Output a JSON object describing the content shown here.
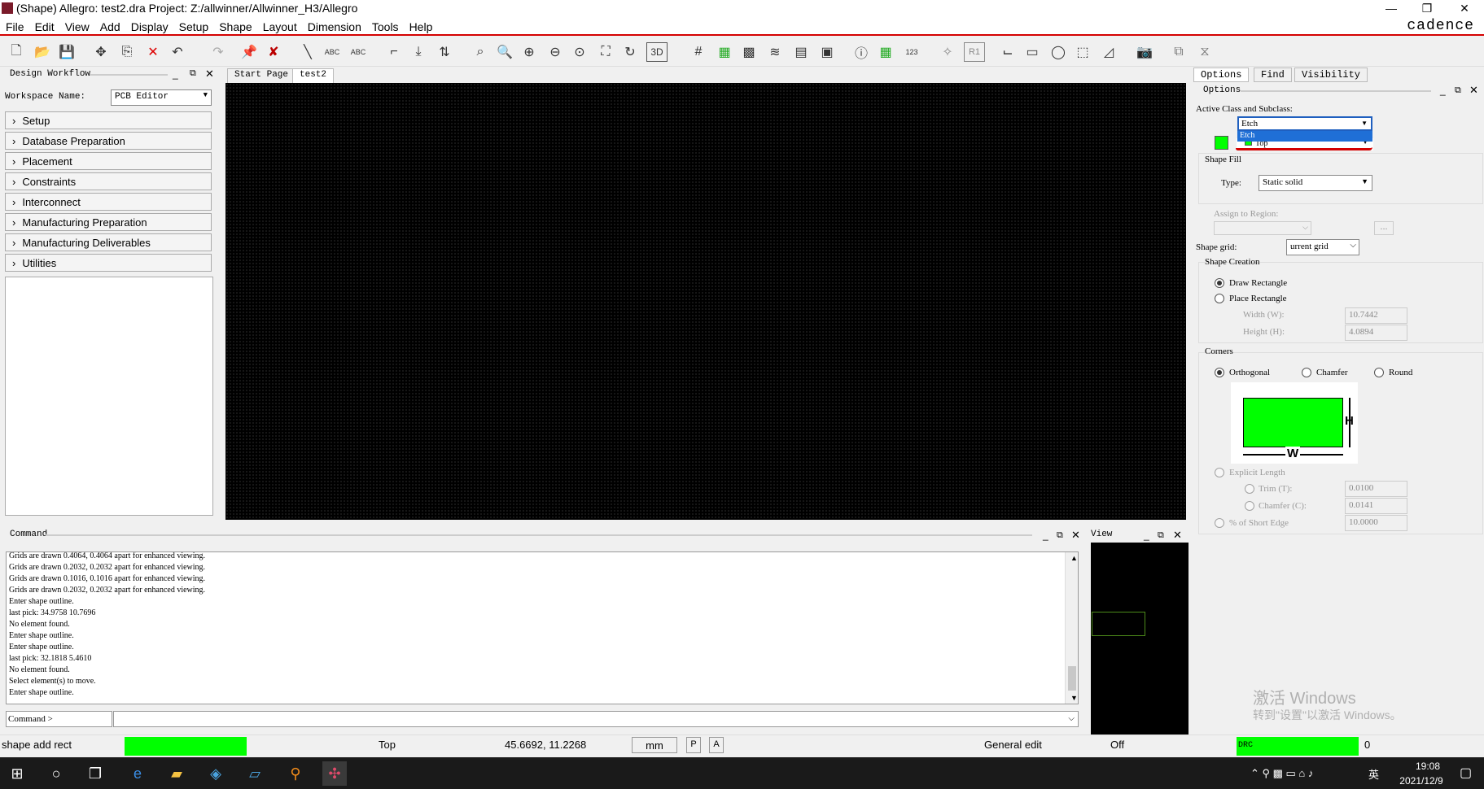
{
  "window": {
    "title": "(Shape) Allegro: test2.dra  Project: Z:/allwinner/Allwinner_H3/Allegro",
    "brand": "cadence"
  },
  "menu": [
    "File",
    "Edit",
    "View",
    "Add",
    "Display",
    "Setup",
    "Shape",
    "Layout",
    "Dimension",
    "Tools",
    "Help"
  ],
  "workflow": {
    "title": "Design Workflow",
    "workspace_label": "Workspace Name:",
    "workspace_value": "PCB Editor",
    "items": [
      "Setup",
      "Database Preparation",
      "Placement",
      "Constraints",
      "Interconnect",
      "Manufacturing Preparation",
      "Manufacturing Deliverables",
      "Utilities"
    ]
  },
  "tabs": [
    "Start Page",
    "test2"
  ],
  "command": {
    "title": "Command",
    "log": [
      "Grids are drawn 0.4064, 0.4064 apart for enhanced viewing.",
      "Grids are drawn 0.2032, 0.2032 apart for enhanced viewing.",
      "Grids are drawn 0.1016, 0.1016 apart for enhanced viewing.",
      "Grids are drawn 0.2032, 0.2032 apart for enhanced viewing.",
      "Enter shape outline.",
      "last pick:  34.9758 10.7696",
      "No element found.",
      "Enter shape outline.",
      "Enter shape outline.",
      "last pick:  32.1818 5.4610",
      "No element found.",
      "Select element(s) to move.",
      "Enter shape outline."
    ],
    "prompt": "Command >"
  },
  "view_title": "View",
  "options": {
    "tabs": [
      "Options",
      "Find",
      "Visibility"
    ],
    "title": "Options",
    "active_class_label": "Active Class and Subclass:",
    "class_value": "Etch",
    "class_option": "Etch",
    "subclass_value": "Top",
    "shape_fill_label": "Shape Fill",
    "type_label": "Type:",
    "type_value": "Static solid",
    "assign_region_label": "Assign to Region:",
    "assign_btn": "...",
    "shape_grid_label": "Shape grid:",
    "shape_grid_value": "urrent grid",
    "shape_creation_label": "Shape Creation",
    "draw_rect": "Draw Rectangle",
    "place_rect": "Place Rectangle",
    "width_label": "Width (W):",
    "width_value": "10.7442",
    "height_label": "Height (H):",
    "height_value": "4.0894",
    "corners_label": "Corners",
    "orthogonal": "Orthogonal",
    "chamfer": "Chamfer",
    "round": "Round",
    "diag_h": "H",
    "diag_w": "W",
    "explicit_length": "Explicit Length",
    "trim_label": "Trim (T):",
    "trim_value": "0.0100",
    "chamfer_c_label": "Chamfer (C):",
    "chamfer_c_value": "0.0141",
    "pct_label": "% of Short Edge",
    "pct_value": "10.0000"
  },
  "status": {
    "command": "shape add rect",
    "layer": "Top",
    "coords": "45.6692, 11.2268",
    "units": "mm",
    "p": "P",
    "a": "A",
    "mode": "General edit",
    "off": "Off",
    "drc": "DRC",
    "drc_count": "0"
  },
  "watermark": {
    "line1": "激活 Windows",
    "line2": "转到\"设置\"以激活 Windows。"
  },
  "taskbar": {
    "time": "19:08",
    "date": "2021/12/9",
    "ime": "英"
  },
  "colors": {
    "accent_red": "#d40000",
    "etch_green": "#00ff00",
    "canvas": "#000000"
  }
}
